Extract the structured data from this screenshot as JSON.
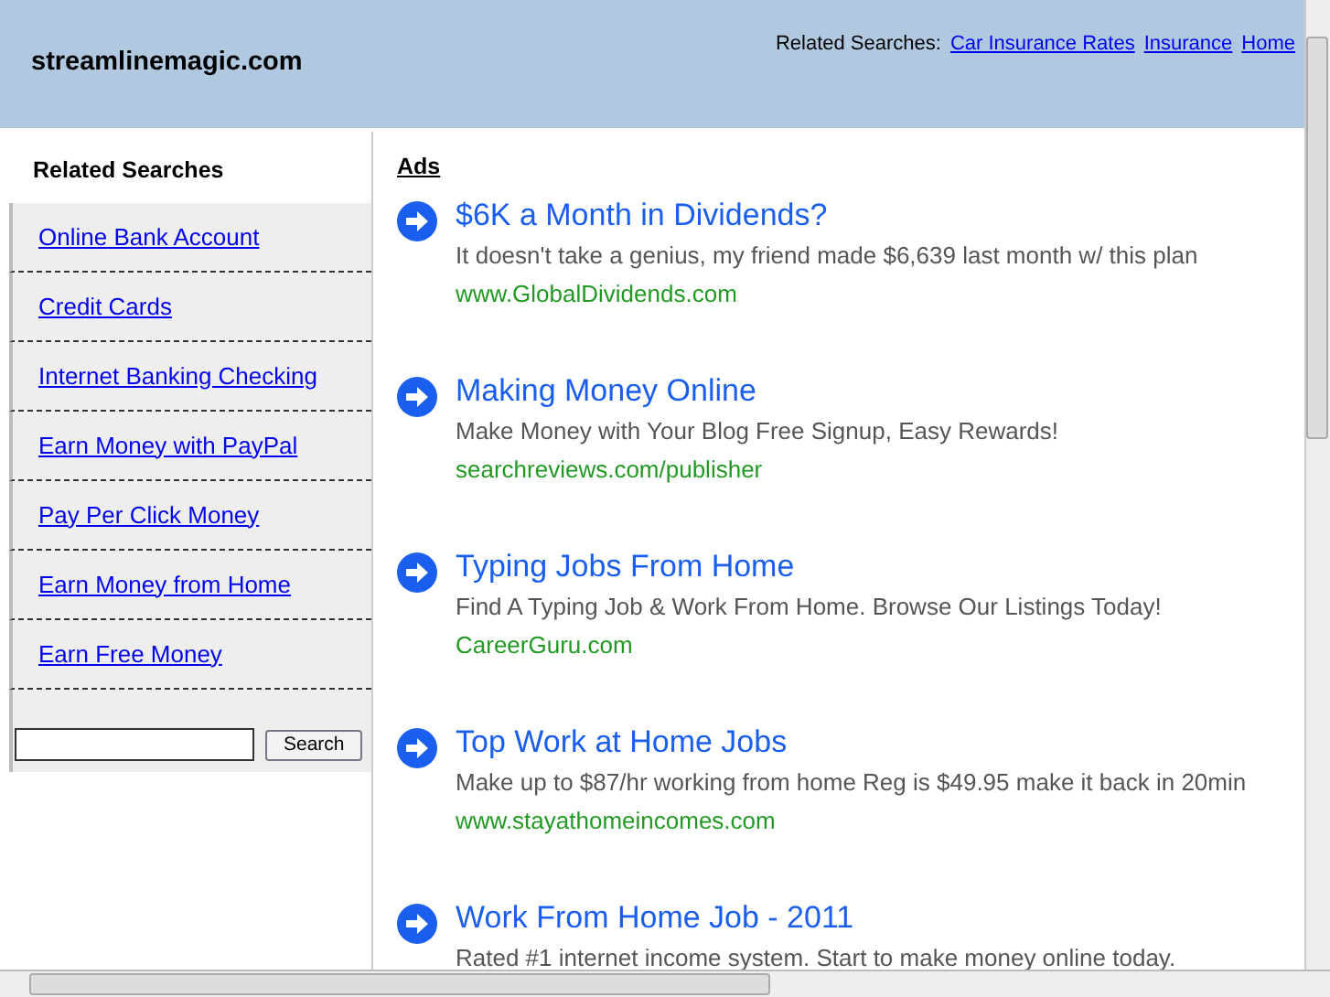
{
  "header": {
    "site_title": "streamlinemagic.com",
    "related_label": "Related Searches:",
    "related_links": [
      "Car Insurance Rates",
      "Insurance",
      "Home"
    ]
  },
  "sidebar": {
    "heading": "Related Searches",
    "items": [
      "Online Bank Account",
      "Credit Cards",
      "Internet Banking Checking",
      "Earn Money with PayPal",
      "Pay Per Click Money",
      "Earn Money from Home",
      "Earn Free Money"
    ],
    "search_button": "Search"
  },
  "ads": {
    "heading": "Ads",
    "items": [
      {
        "title": "$6K a Month in Dividends?",
        "description": "It doesn't take a genius, my friend made $6,639 last month w/ this plan",
        "url": "www.GlobalDividends.com"
      },
      {
        "title": "Making Money Online",
        "description": "Make Money with Your Blog Free Signup, Easy Rewards!",
        "url": "searchreviews.com/publisher"
      },
      {
        "title": "Typing Jobs From Home",
        "description": "Find A Typing Job & Work From Home. Browse Our Listings Today!",
        "url": "CareerGuru.com"
      },
      {
        "title": "Top Work at Home Jobs",
        "description": "Make up to $87/hr working from home Reg is $49.95 make it back in 20min",
        "url": "www.stayathomeincomes.com"
      },
      {
        "title": "Work From Home Job - 2011",
        "description": "Rated #1 internet income system. Start to make money online today."
      }
    ]
  }
}
